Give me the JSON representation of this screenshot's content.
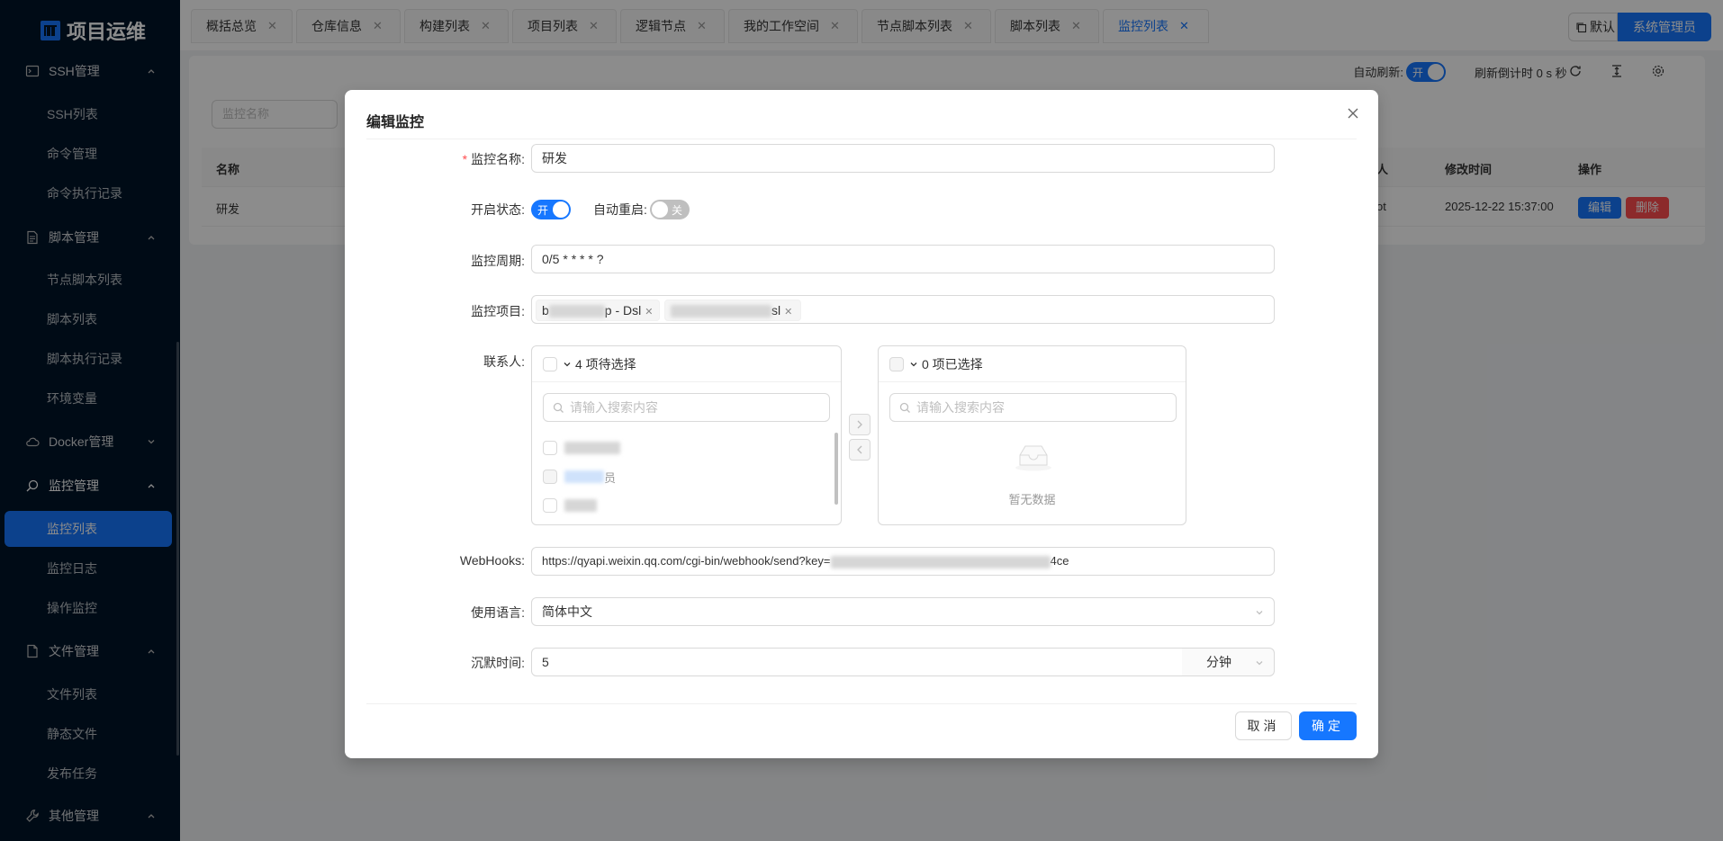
{
  "sidebar": {
    "logo": "项目运维",
    "groups": [
      {
        "label": "SSH管理"
      },
      {
        "label": "脚本管理"
      },
      {
        "label": "Docker管理"
      },
      {
        "label": "监控管理"
      },
      {
        "label": "文件管理"
      },
      {
        "label": "其他管理"
      }
    ],
    "items": [
      "SSH列表",
      "命令管理",
      "命令执行记录",
      "节点脚本列表",
      "脚本列表",
      "脚本执行记录",
      "环境变量",
      "监控列表",
      "监控日志",
      "操作监控",
      "文件列表",
      "静态文件",
      "发布任务"
    ]
  },
  "tabs": [
    "概括总览",
    "仓库信息",
    "构建列表",
    "项目列表",
    "逻辑节点",
    "我的工作空间",
    "节点脚本列表",
    "脚本列表",
    "监控列表"
  ],
  "topright": {
    "workspace": "默认",
    "user": "系统管理员"
  },
  "toolbar": {
    "auto_refresh": "自动刷新:",
    "switch_on": "开",
    "countdown": "刷新倒计时 0 s 秒"
  },
  "table": {
    "search_placeholder": "监控名称",
    "headers": {
      "name": "名称",
      "person": "人",
      "modified": "修改时间",
      "action": "操作"
    },
    "row": {
      "name": "研发",
      "person": "ot",
      "modified": "2025-12-22 15:37:00",
      "edit": "编辑",
      "delete": "删除"
    }
  },
  "modal": {
    "title": "编辑监控",
    "labels": {
      "name": "监控名称:",
      "status": "开启状态:",
      "restart": "自动重启:",
      "cycle": "监控周期:",
      "projects": "监控项目:",
      "contacts": "联系人:",
      "webhooks": "WebHooks:",
      "language": "使用语言:",
      "silence": "沉默时间:"
    },
    "values": {
      "name": "研发",
      "status_switch": "开",
      "restart_switch": "关",
      "cycle": "0/5 * * * * ?",
      "project_tags": [
        "b",
        "p - Dsl",
        "sl"
      ],
      "webhook_prefix": "https://qyapi.weixin.qq.com/cgi-bin/webhook/send?key=",
      "webhook_suffix": "4ce",
      "language": "简体中文",
      "silence": "5",
      "silence_unit": "分钟"
    },
    "transfer": {
      "left_title": "4 项待选择",
      "right_title": "0 项已选择",
      "search_placeholder": "请输入搜索内容",
      "left_items": [
        "",
        "员",
        ""
      ],
      "empty": "暂无数据"
    },
    "buttons": {
      "cancel": "取消",
      "ok": "确定"
    }
  }
}
